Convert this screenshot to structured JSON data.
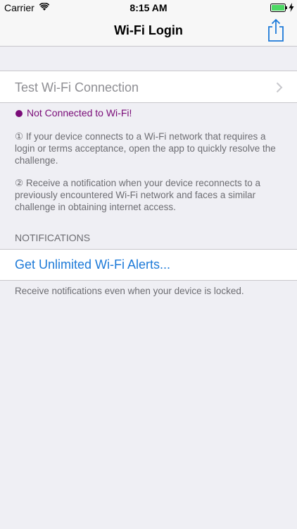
{
  "status_bar": {
    "carrier": "Carrier",
    "time": "8:15 AM",
    "battery_color": "#4cd964"
  },
  "nav": {
    "title": "Wi-Fi Login",
    "share_icon": "share-icon",
    "tint_color": "#1d7ad8"
  },
  "test_cell": {
    "label": "Test Wi-Fi Connection"
  },
  "status": {
    "text": "Not Connected to Wi-Fi!",
    "color": "#7a0c78"
  },
  "info": {
    "item1": "① If your device connects to a Wi-Fi network that requires a login or terms acceptance, open the app to quickly resolve the challenge.",
    "item2": "② Receive a notification when your device reconnects to a previously encountered Wi-Fi network and faces a similar challenge in obtaining internet access."
  },
  "notifications": {
    "header": "NOTIFICATIONS",
    "alerts_label": "Get Unlimited Wi-Fi Alerts...",
    "footer": "Receive notifications even when your device is locked."
  }
}
